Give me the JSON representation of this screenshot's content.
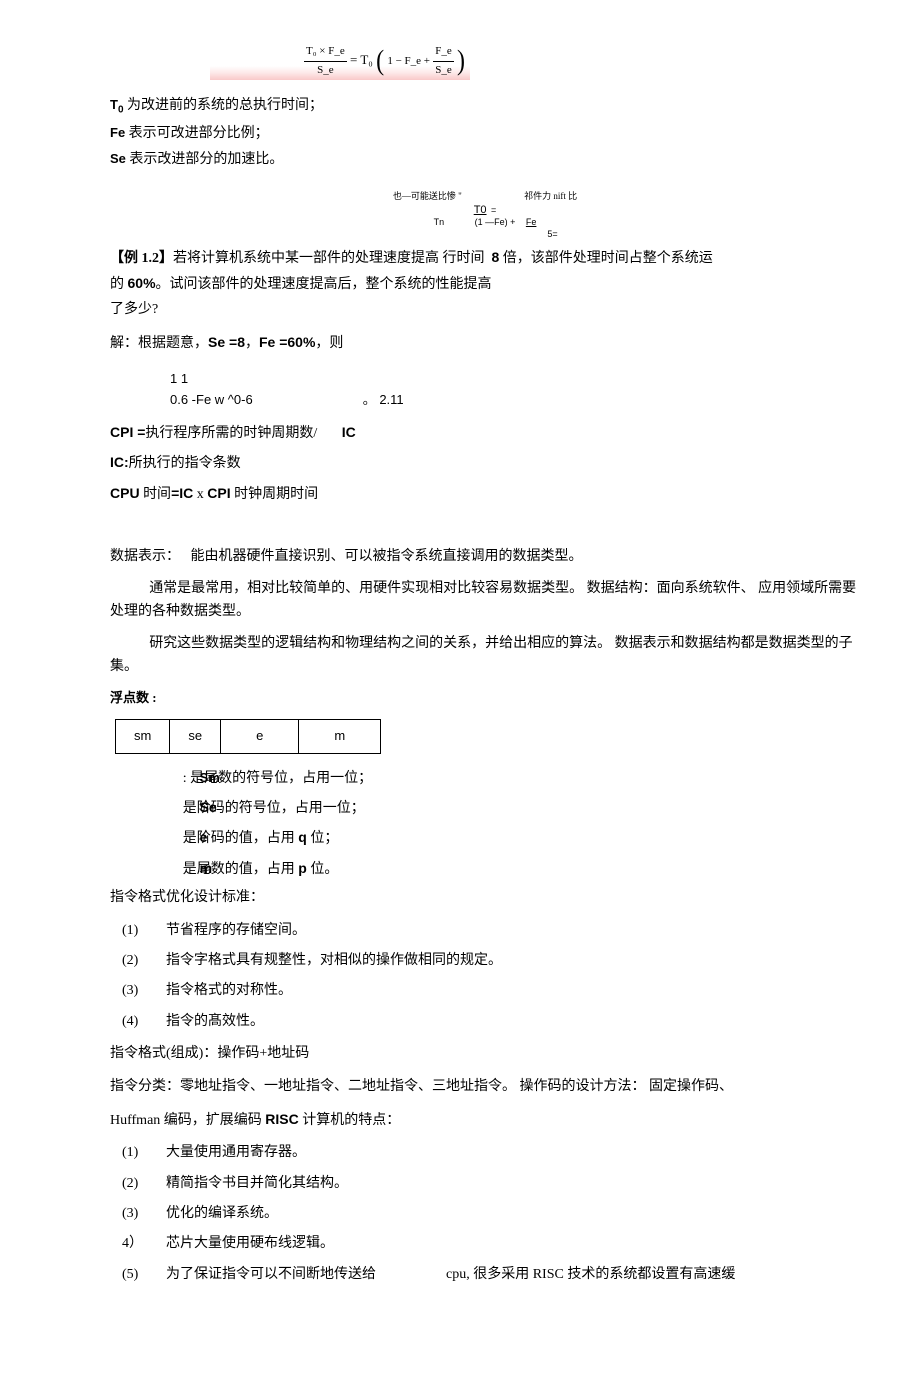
{
  "formula_top": {
    "lhs_num": "T₀ × F_e",
    "lhs_den": "S_e",
    "mid": "= T₀",
    "rhs_text1": "1 − F_e +",
    "rhs_num": "F_e",
    "rhs_den": "S_e"
  },
  "defs": {
    "t0": "T",
    "t0_sub": "0",
    "t0_text": " 为改进前的系统的总执行时间；",
    "fe": "Fe",
    "fe_text": " 表示可改进部分比例；",
    "se": "Se",
    "se_text": " 表示改进部分的加速比。"
  },
  "small_formula": {
    "top_left": "也—可能送比惨 \"",
    "top_right": "祁件力 nift 比",
    "frac1_num": "T0",
    "frac1_den": "Tn",
    "eq": "=",
    "mid": "(1 —Fe) +",
    "frac2_num": "Fe",
    "frac2_den": "5="
  },
  "example": {
    "tag": "【例 1.2】",
    "text1": "若将计算机系统中某一部件的处理速度提高 行时间",
    "eight": "8",
    "text1b": " 倍，该部件处理时间占整个系统运",
    "text2_a": "的 ",
    "sixty": "60%",
    "text2_b": "。试问该部件的处理速度提高后，整个系统的性能提高",
    "text3": "了多少?"
  },
  "solve": {
    "text_a": "解：根据题意，",
    "se": "Se =8",
    "comma": "，",
    "fe": "Fe =60%",
    "tail": "，则"
  },
  "calc": {
    "line1": "1 1",
    "line2_a": "0.6 -Fe w ^0-6",
    "line2_b": "。",
    "line2_c": "2.11"
  },
  "cpi": {
    "l1_a": "CPI =",
    "l1_b": "执行程序所需的时钟周期数/",
    "l1_c": "IC",
    "l2_a": "IC:",
    "l2_b": "所执行的指令条数",
    "l3_a": "CPU",
    "l3_b": " 时间",
    "l3_c": "=IC",
    "l3_d": " x ",
    "l3_e": "CPI",
    "l3_f": " 时钟周期时间"
  },
  "sec2": {
    "p1_a": "数据表示：",
    "p1_b": "能由机器硬件直接识别、可以被指令系统直接调用的数据类型。",
    "p2": "通常是最常用，相对比较简单的、用硬件实现相对比较容易数据类型。 数据结构：面向系统软件、 应用领域所需要处理的各种数据类型。",
    "p3": "研究这些数据类型的逻辑结构和物理结构之间的关系，并给出相应的算法。 数据表示和数据结构都是数据类型的子集。",
    "fp_title": "浮点数 :"
  },
  "fp_table": {
    "c1": "sm",
    "c2": "se",
    "c3": "e",
    "c4": "m"
  },
  "fp_defs": {
    "sm": "Sm",
    "sm_t": ": 是尾数的符号位，占用一位；",
    "se": "Se",
    "se_t": "是阶码的符号位，占用一位；",
    "e": "e",
    "e_t_a": "是阶码的值，占用 ",
    "e_q": "q",
    "e_t_b": " 位；",
    "m": "m",
    "m_t_a": "是尾数的值，占用 ",
    "m_p": "p",
    "m_t_b": " 位。"
  },
  "opt_title": "指令格式优化设计标准：",
  "opt": {
    "n1": "(1)",
    "t1": "节省程序的存储空间。",
    "n2": "(2)",
    "t2": "指令字格式具有规整性，对相似的操作做相同的规定。",
    "n3": "(3)",
    "t3": "指令格式的对称性。",
    "n4": "(4)",
    "t4": "指令的髙效性。"
  },
  "fmt_line_a": "指令格式(组成)：操作码+地址码",
  "fmt_line_b": "指令分类：零地址指令、一地址指令、二地址指令、三地址指令。 操作码的设计方法：   固定操作码、",
  "fmt_line_c_a": "Huffman",
  "fmt_line_c_b": " 编码，扩展编码 ",
  "fmt_line_c_c": "RISC",
  "fmt_line_c_d": " 计算机的特点：",
  "risc": {
    "n1": "(1)",
    "t1": "大量使用通用寄存器。",
    "n2": "(2)",
    "t2": "精简指令书目并简化其结构。",
    "n3": "(3)",
    "t3": "优化的编译系统。",
    "n4": "4）",
    "t4": "芯片大量使用硬布线逻辑。",
    "n5": "(5)",
    "t5_a": "为了保证指令可以不间断地传送给",
    "t5_b": "cpu,",
    "t5_c": " 很多采用 RISC 技术的系统都设置有高速缓"
  }
}
